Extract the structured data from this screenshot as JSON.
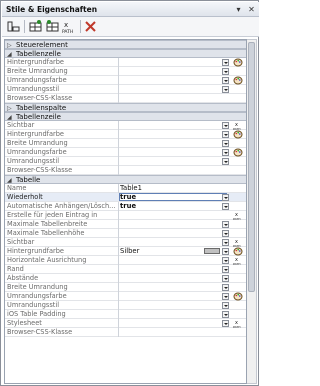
{
  "window": {
    "title": "Stile & Eigenschaften"
  },
  "toolbar": {
    "buttons": [
      "layout-icon",
      "add-style-icon",
      "insert-style-icon",
      "xpath-style-icon",
      "delete-icon"
    ]
  },
  "sections": {
    "steuerelement": "Steuerelement",
    "tabellenzelle": "Tabellenzelle",
    "tabellenspalte": "Tabellenspalte",
    "tabellenzeile": "Tabellenzeile",
    "tabelle": "Tabelle"
  },
  "rows": {
    "r1": "Hintergrundfarbe",
    "r2": "Breite Umrandung",
    "r3": "Umrandungsfarbe",
    "r4": "Umrandungsstil",
    "r5": "Browser-CSS-Klasse",
    "r6": "Sichtbar",
    "r7": "Hintergrundfarbe",
    "r8": "Breite Umrandung",
    "r9": "Umrandungsfarbe",
    "r10": "Umrandungsstil",
    "r11": "Browser-CSS-Klasse",
    "r12": "Name",
    "r13": "Wiederholt",
    "r14": "Automatische Anhängen/Lösch...",
    "r15": "Erstelle für jeden Eintrag in",
    "r16": "Maximale Tabellenbreite",
    "r17": "Maximale Tabellenhöhe",
    "r18": "Sichtbar",
    "r19": "Hintergrundfarbe",
    "r20": "Horizontale Ausrichtung",
    "r21": "Rand",
    "r22": "Abstände",
    "r23": "Breite Umrandung",
    "r24": "Umrandungsfarbe",
    "r25": "Umrandungsstil",
    "r26": "iOS Table Padding",
    "r27": "Stylesheet",
    "r28": "Browser-CSS-Klasse"
  },
  "values": {
    "name": "Table1",
    "wiederholt": "true",
    "auto": "true",
    "hintergrundfarbe": "Silber"
  },
  "colors": {
    "swatch": "#c0c0c0"
  }
}
